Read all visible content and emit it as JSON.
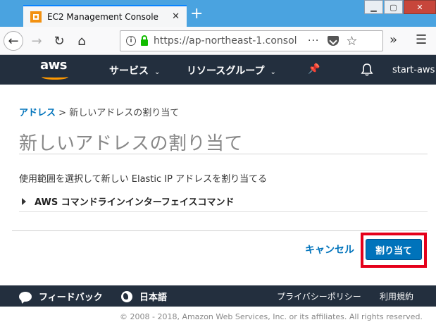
{
  "browser": {
    "tab_title": "EC2 Management Console",
    "url_host": "https://ap-northeast-1.consol",
    "url_more": "···"
  },
  "aws_nav": {
    "logo_text": "aws",
    "services_label": "サービス",
    "resource_groups_label": "リソースグループ",
    "account_label": "start-aws"
  },
  "breadcrumb": {
    "parent": "アドレス",
    "separator": ">",
    "current": "新しいアドレスの割り当て"
  },
  "page": {
    "title": "新しいアドレスの割り当て",
    "description": "使用範囲を選択して新しい Elastic IP アドレスを割り当てる",
    "cli_toggle_label": "AWS コマンドラインインターフェイスコマンド"
  },
  "actions": {
    "cancel_label": "キャンセル",
    "allocate_label": "割り当て"
  },
  "footer": {
    "feedback_label": "フィードバック",
    "language_label": "日本語",
    "privacy_label": "プライバシーポリシー",
    "terms_label": "利用規約",
    "copyright": "© 2008 - 2018, Amazon Web Services, Inc. or its affiliates. All rights reserved."
  },
  "colors": {
    "aws_nav_bg": "#232f3e",
    "link": "#0073bb",
    "primary_button": "#0073bb",
    "highlight": "#e5001a",
    "aws_orange": "#ff9900"
  }
}
